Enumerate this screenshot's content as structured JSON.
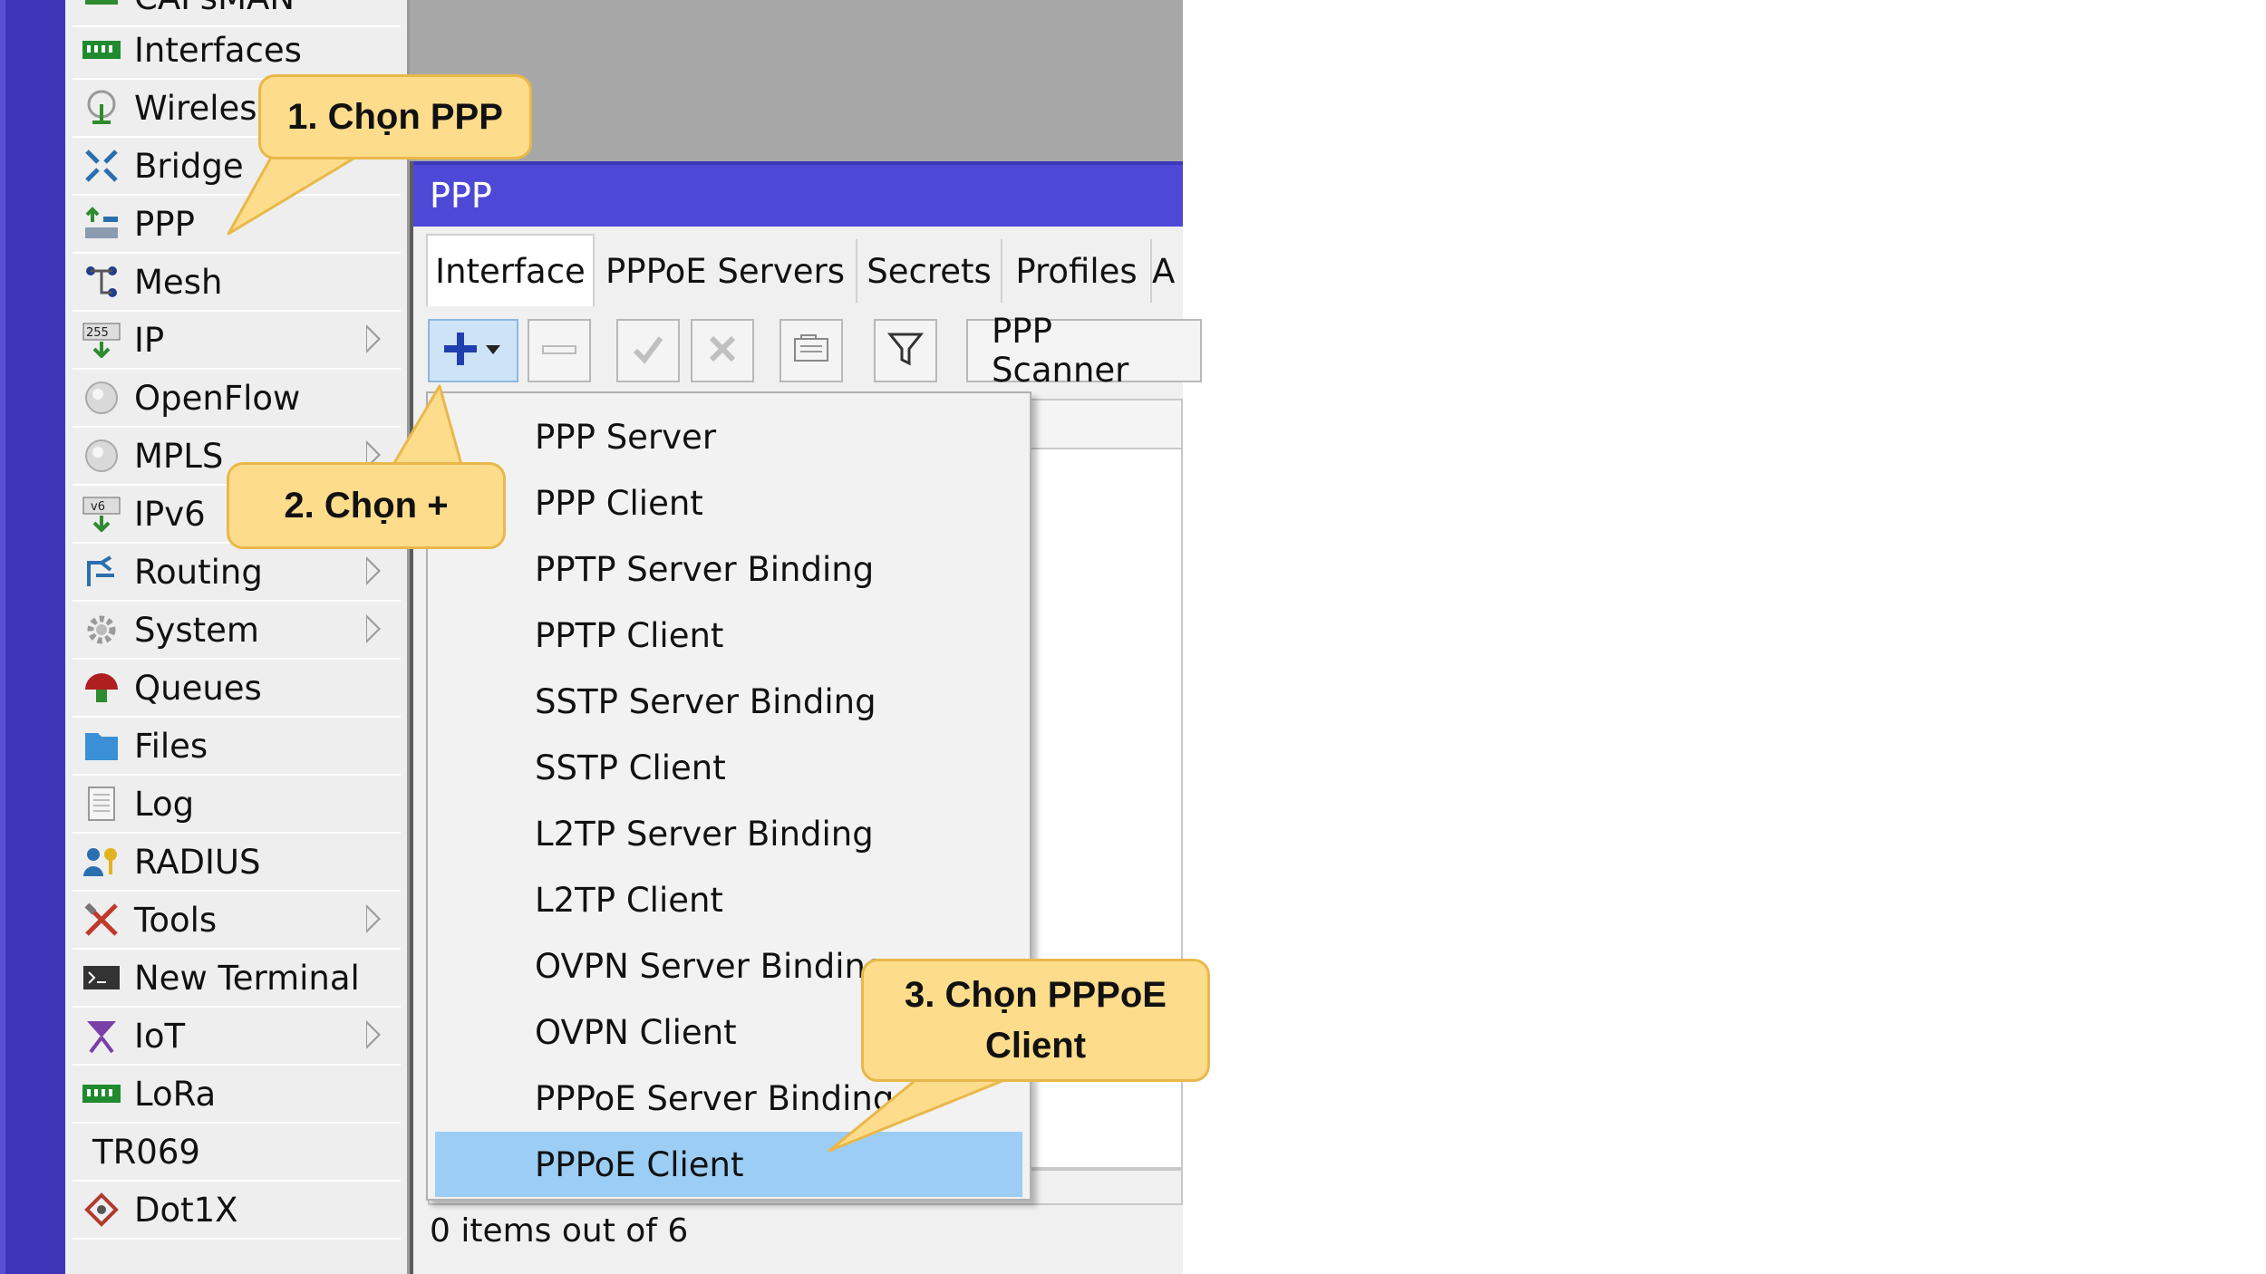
{
  "sidebar": {
    "items": [
      {
        "label": "CAPsMAN",
        "icon": "capsman-icon",
        "submenu": false
      },
      {
        "label": "Interfaces",
        "icon": "interfaces-icon",
        "submenu": false
      },
      {
        "label": "Wireless",
        "icon": "wireless-icon",
        "submenu": false
      },
      {
        "label": "Bridge",
        "icon": "bridge-icon",
        "submenu": false
      },
      {
        "label": "PPP",
        "icon": "ppp-icon",
        "submenu": false
      },
      {
        "label": "Mesh",
        "icon": "mesh-icon",
        "submenu": false
      },
      {
        "label": "IP",
        "icon": "ip-icon",
        "submenu": true
      },
      {
        "label": "OpenFlow",
        "icon": "openflow-icon",
        "submenu": false
      },
      {
        "label": "MPLS",
        "icon": "mpls-icon",
        "submenu": true
      },
      {
        "label": "IPv6",
        "icon": "ipv6-icon",
        "submenu": true
      },
      {
        "label": "Routing",
        "icon": "routing-icon",
        "submenu": true
      },
      {
        "label": "System",
        "icon": "system-icon",
        "submenu": true
      },
      {
        "label": "Queues",
        "icon": "queues-icon",
        "submenu": false
      },
      {
        "label": "Files",
        "icon": "files-icon",
        "submenu": false
      },
      {
        "label": "Log",
        "icon": "log-icon",
        "submenu": false
      },
      {
        "label": "RADIUS",
        "icon": "radius-icon",
        "submenu": false
      },
      {
        "label": "Tools",
        "icon": "tools-icon",
        "submenu": true
      },
      {
        "label": "New Terminal",
        "icon": "terminal-icon",
        "submenu": false
      },
      {
        "label": "IoT",
        "icon": "iot-icon",
        "submenu": true
      },
      {
        "label": "LoRa",
        "icon": "lora-icon",
        "submenu": false
      },
      {
        "label": "TR069",
        "icon": "",
        "submenu": false
      },
      {
        "label": "Dot1X",
        "icon": "dot1x-icon",
        "submenu": false
      }
    ]
  },
  "window": {
    "title": "PPP",
    "tabs": [
      "Interface",
      "PPPoE Servers",
      "Secrets",
      "Profiles",
      "A"
    ],
    "active_tab": "Interface",
    "toolbar": {
      "add": "add-icon",
      "remove": "minus-icon",
      "enable": "check-icon",
      "disable": "cross-icon",
      "comment": "comment-icon",
      "filter": "filter-icon",
      "scanner_label": "PPP Scanner"
    },
    "status_text": "0 items out of 6"
  },
  "dropdown": {
    "items": [
      "PPP Server",
      "PPP Client",
      "PPTP Server Binding",
      "PPTP Client",
      "SSTP Server Binding",
      "SSTP Client",
      "L2TP Server Binding",
      "L2TP Client",
      "OVPN Server Binding",
      "OVPN Client",
      "PPPoE Server Binding",
      "PPPoE Client"
    ],
    "selected": "PPPoE Client"
  },
  "callouts": {
    "step1": "1. Chọn PPP",
    "step2": "2. Chọn +",
    "step3_line1": "3. Chọn PPPoE",
    "step3_line2": "Client"
  },
  "colors": {
    "titlebar": "#4d49d6",
    "selected_item": "#9ccdf4",
    "callout_fill": "#fddc8c",
    "callout_border": "#e9b84a"
  }
}
